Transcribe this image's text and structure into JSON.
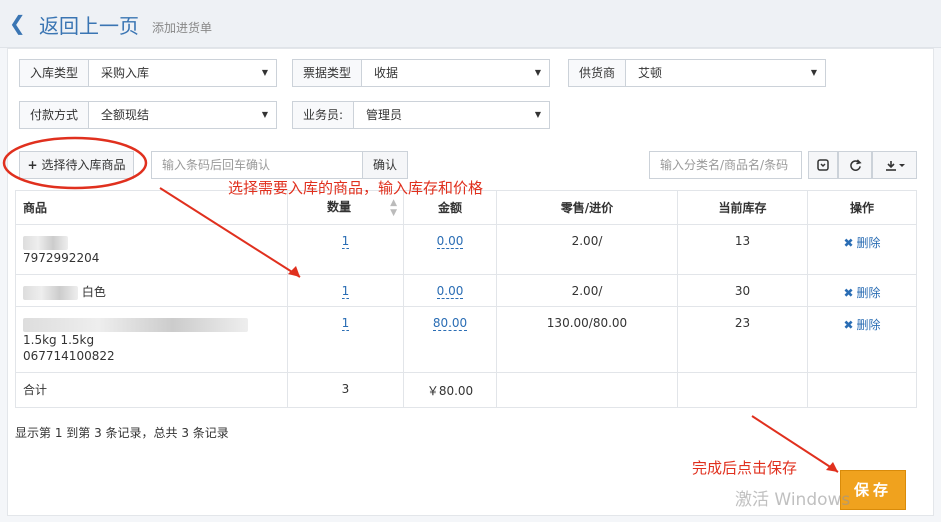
{
  "header": {
    "back_label": "返回上一页",
    "subtitle": "添加进货单"
  },
  "form": {
    "inbound_type": {
      "label": "入库类型",
      "value": "采购入库"
    },
    "invoice_type": {
      "label": "票据类型",
      "value": "收据"
    },
    "supplier": {
      "label": "供货商",
      "value": "艾顿"
    },
    "payment": {
      "label": "付款方式",
      "value": "全额现结"
    },
    "salesperson": {
      "label": "业务员:",
      "value": "管理员"
    }
  },
  "toolbar": {
    "select_products_label": "选择待入库商品",
    "barcode_placeholder": "输入条码后回车确认",
    "confirm_label": "确认",
    "search_placeholder": "输入分类名/商品名/条码"
  },
  "table": {
    "headers": [
      "商品",
      "数量",
      "金额",
      "零售/进价",
      "当前库存",
      "操作"
    ],
    "rows": [
      {
        "name_line1": "",
        "name_line2": "7972992204",
        "name_line3": "",
        "qty": "1",
        "amount": "0.00",
        "price": "2.00/",
        "stock": "13",
        "action": "删除"
      },
      {
        "name_line1": "白色",
        "name_line2": "",
        "name_line3": "",
        "qty": "1",
        "amount": "0.00",
        "price": "2.00/",
        "stock": "30",
        "action": "删除"
      },
      {
        "name_line1": "",
        "name_line2": "1.5kg 1.5kg",
        "name_line3": "067714100822",
        "qty": "1",
        "amount": "80.00",
        "price": "130.00/80.00",
        "stock": "23",
        "action": "删除"
      }
    ],
    "total_label": "合计",
    "total_qty": "3",
    "total_amount": "￥80.00"
  },
  "summary": "显示第 1 到第 3 条记录，总共 3 条记录",
  "annotations": {
    "instruction": "选择需要入库的商品，输入库存和价格",
    "save_hint": "完成后点击保存"
  },
  "save_label": "保存",
  "watermark": "激活 Windows",
  "colors": {
    "accent": "#3a75b3",
    "save": "#f0a21e",
    "annotation": "#e0301e"
  }
}
